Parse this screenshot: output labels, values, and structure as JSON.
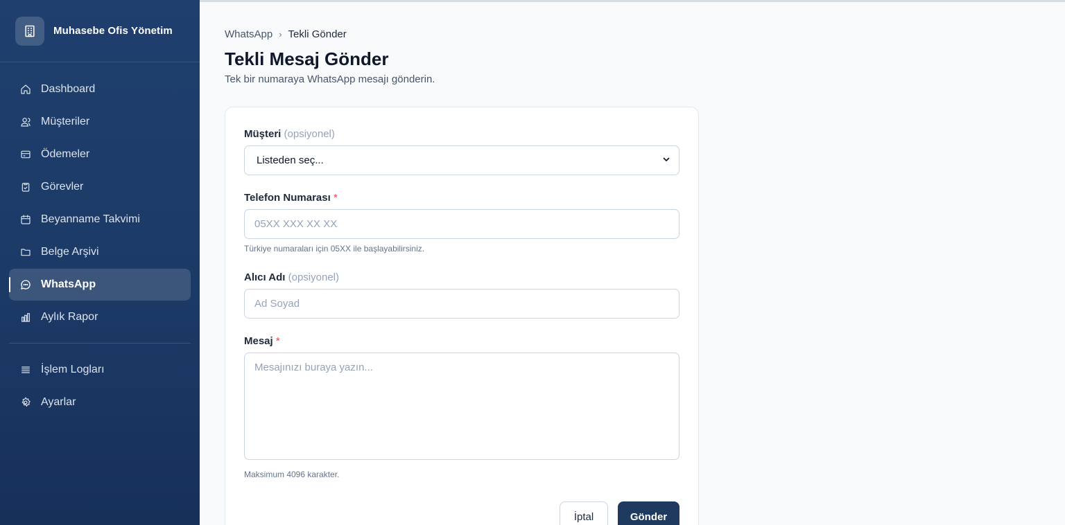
{
  "app": {
    "title": "Muhasebe Ofis Yönetim",
    "logo_icon": "building-icon"
  },
  "sidebar": {
    "items": [
      {
        "label": "Dashboard",
        "icon": "home-icon"
      },
      {
        "label": "Müşteriler",
        "icon": "users-icon"
      },
      {
        "label": "Ödemeler",
        "icon": "credit-card-icon"
      },
      {
        "label": "Görevler",
        "icon": "clipboard-check-icon"
      },
      {
        "label": "Beyanname Takvimi",
        "icon": "calendar-icon"
      },
      {
        "label": "Belge Arşivi",
        "icon": "folder-icon"
      },
      {
        "label": "WhatsApp",
        "icon": "message-circle-icon",
        "active": true
      },
      {
        "label": "Aylık Rapor",
        "icon": "bar-chart-icon"
      }
    ],
    "secondary": [
      {
        "label": "İşlem Logları",
        "icon": "list-icon"
      },
      {
        "label": "Ayarlar",
        "icon": "settings-icon"
      }
    ]
  },
  "breadcrumb": {
    "parent": "WhatsApp",
    "separator": "›",
    "current": "Tekli Gönder"
  },
  "page": {
    "title": "Tekli Mesaj Gönder",
    "subtitle": "Tek bir numaraya WhatsApp mesajı gönderin."
  },
  "form": {
    "customer": {
      "label": "Müşteri",
      "optional": "(opsiyonel)",
      "selected": "Listeden seç..."
    },
    "phone": {
      "label": "Telefon Numarası",
      "required": "*",
      "placeholder": "05XX XXX XX XX",
      "hint": "Türkiye numaraları için 05XX ile başlayabilirsiniz."
    },
    "recipient": {
      "label": "Alıcı Adı",
      "optional": "(opsiyonel)",
      "placeholder": "Ad Soyad"
    },
    "message": {
      "label": "Mesaj",
      "required": "*",
      "placeholder": "Mesajınızı buraya yazın...",
      "hint": "Maksimum 4096 karakter."
    },
    "cancel_label": "İptal",
    "submit_label": "Gönder"
  },
  "colors": {
    "sidebar": "#1c3a66",
    "primary_button": "#1e3a5f",
    "required": "#ef4444",
    "background": "#f8fafc"
  }
}
